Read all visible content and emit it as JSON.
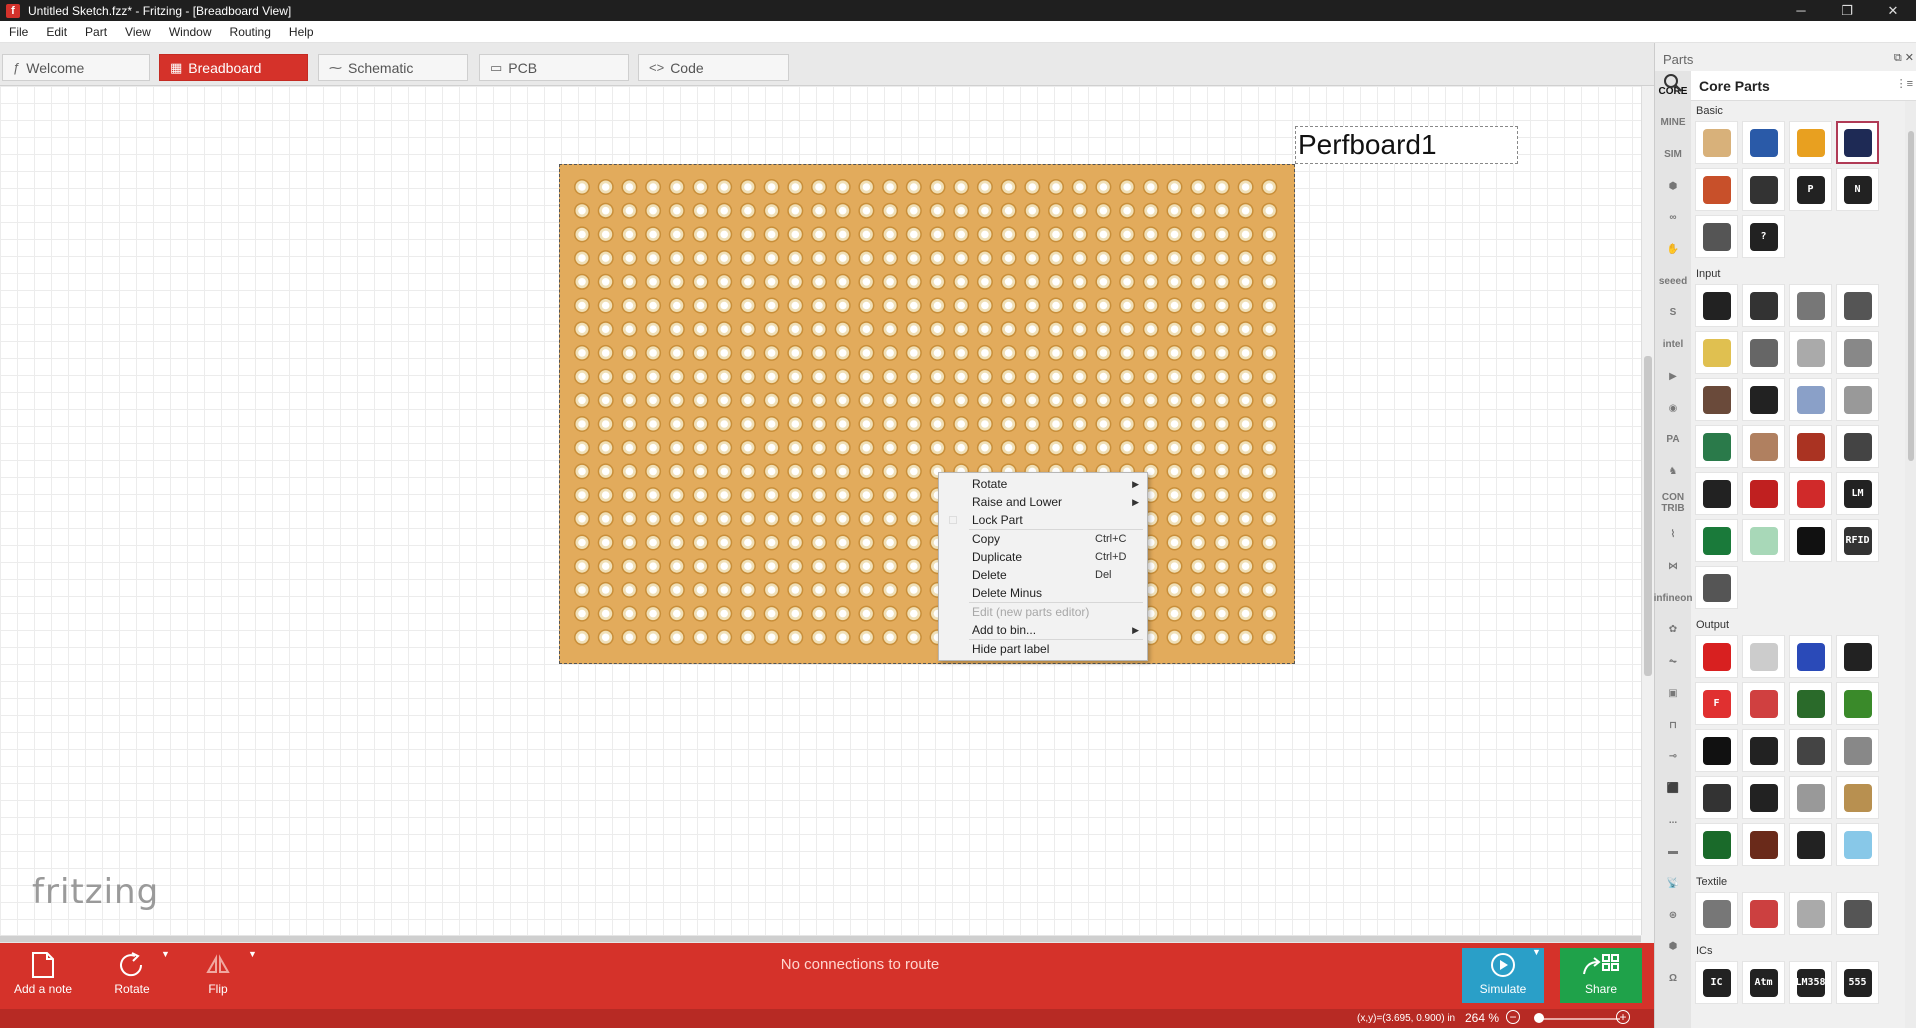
{
  "window": {
    "title": "Untitled Sketch.fzz* - Fritzing - [Breadboard View]",
    "controls": [
      "─",
      "❐",
      "✕"
    ]
  },
  "menu": [
    "File",
    "Edit",
    "Part",
    "View",
    "Window",
    "Routing",
    "Help"
  ],
  "tabs": [
    {
      "label": "Welcome",
      "icon": "ƒ",
      "active": false
    },
    {
      "label": "Breadboard",
      "icon": "▦",
      "active": true
    },
    {
      "label": "Schematic",
      "icon": "⁓",
      "active": false
    },
    {
      "label": "PCB",
      "icon": "▭",
      "active": false
    },
    {
      "label": "Code",
      "icon": "<>",
      "active": false
    }
  ],
  "canvas": {
    "part_label": "Perfboard1",
    "watermark": "fritzing",
    "perfboard": {
      "columns": 30,
      "rows": 20,
      "color": "#e2ab5c"
    }
  },
  "context_menu": [
    {
      "label": "Rotate",
      "shortcut": "",
      "submenu": true,
      "disabled": false
    },
    {
      "label": "Raise and Lower",
      "shortcut": "",
      "submenu": true,
      "disabled": false
    },
    {
      "label": "Lock Part",
      "shortcut": "",
      "submenu": false,
      "disabled": false
    },
    {
      "label": "Copy",
      "shortcut": "Ctrl+C",
      "submenu": false,
      "disabled": false
    },
    {
      "label": "Duplicate",
      "shortcut": "Ctrl+D",
      "submenu": false,
      "disabled": false
    },
    {
      "label": "Delete",
      "shortcut": "Del",
      "submenu": false,
      "disabled": false
    },
    {
      "label": "Delete Minus",
      "shortcut": "",
      "submenu": false,
      "disabled": false
    },
    {
      "label": "Edit (new parts editor)",
      "shortcut": "",
      "submenu": false,
      "disabled": true
    },
    {
      "label": "Add to bin...",
      "shortcut": "",
      "submenu": true,
      "disabled": false
    },
    {
      "label": "Hide part label",
      "shortcut": "",
      "submenu": false,
      "disabled": false
    }
  ],
  "toolbar": {
    "add_note": "Add a note",
    "rotate": "Rotate",
    "flip": "Flip",
    "route_status": "No connections to route",
    "simulate": "Simulate",
    "share": "Share"
  },
  "status": {
    "coords": "(x,y)=(3.695, 0.900) in",
    "zoom": "264 %"
  },
  "parts_panel": {
    "title": "Parts",
    "header": "Core Parts",
    "rail": [
      "CORE",
      "MINE",
      "SIM",
      "⬢",
      "∞",
      "✋",
      "seeed",
      "S",
      "intel",
      "▶",
      "◉",
      "PA",
      "♞",
      "CON TRIB",
      "⌇",
      "⋈",
      "infineon",
      "✿",
      "⏦",
      "▣",
      "⊓",
      "⊸",
      "⬛",
      "...",
      "▬",
      "📡",
      "⊛",
      "⬢",
      "Ω"
    ],
    "sections": [
      {
        "label": "Basic",
        "tiles": [
          {
            "name": "resistor",
            "color": "#d8b17a",
            "text": ""
          },
          {
            "name": "ceramic-capacitor",
            "color": "#2a5aa8",
            "text": ""
          },
          {
            "name": "tantalum-capacitor",
            "color": "#e8a020",
            "text": ""
          },
          {
            "name": "electrolytic-capacitor",
            "color": "#1e2a55",
            "text": ""
          },
          {
            "name": "inductor",
            "color": "#c8502a",
            "text": ""
          },
          {
            "name": "diode",
            "color": "#333333",
            "text": ""
          },
          {
            "name": "pnp-transistor",
            "color": "#222222",
            "text": "P"
          },
          {
            "name": "npn-transistor",
            "color": "#222222",
            "text": "N"
          },
          {
            "name": "fet",
            "color": "#555555",
            "text": ""
          },
          {
            "name": "mystery-part",
            "color": "#222222",
            "text": "?"
          }
        ]
      },
      {
        "label": "Input",
        "tiles": [
          {
            "name": "potentiometer",
            "color": "#222222",
            "text": ""
          },
          {
            "name": "slide-potentiometer",
            "color": "#333333",
            "text": ""
          },
          {
            "name": "wire-sensor",
            "color": "#777777",
            "text": ""
          },
          {
            "name": "strip-sensor",
            "color": "#555555",
            "text": ""
          },
          {
            "name": "trimmer",
            "color": "#e0c050",
            "text": ""
          },
          {
            "name": "rotary-encoder",
            "color": "#666666",
            "text": ""
          },
          {
            "name": "dip-switch",
            "color": "#aaaaaa",
            "text": ""
          },
          {
            "name": "reed-switch",
            "color": "#888888",
            "text": ""
          },
          {
            "name": "pushbutton",
            "color": "#6a4a3a",
            "text": ""
          },
          {
            "name": "toggle-switch",
            "color": "#222222",
            "text": ""
          },
          {
            "name": "piezo",
            "color": "#8aa0c8",
            "text": ""
          },
          {
            "name": "tilt-switch",
            "color": "#999999",
            "text": ""
          },
          {
            "name": "joystick",
            "color": "#2a7a4a",
            "text": ""
          },
          {
            "name": "flex-sensor",
            "color": "#b08060",
            "text": ""
          },
          {
            "name": "fsr",
            "color": "#aa3322",
            "text": ""
          },
          {
            "name": "pir-sensor",
            "color": "#444444",
            "text": ""
          },
          {
            "name": "rotary-knob",
            "color": "#222222",
            "text": ""
          },
          {
            "name": "red-breakout",
            "color": "#c02020",
            "text": ""
          },
          {
            "name": "red-sensor-board",
            "color": "#d02a2a",
            "text": ""
          },
          {
            "name": "temp-sensor",
            "color": "#222222",
            "text": "LM"
          },
          {
            "name": "green-board",
            "color": "#1a7a3a",
            "text": ""
          },
          {
            "name": "glass-tube",
            "color": "#a8d8b8",
            "text": ""
          },
          {
            "name": "microphone",
            "color": "#111111",
            "text": ""
          },
          {
            "name": "rfid-reader",
            "color": "#333333",
            "text": "RFID"
          },
          {
            "name": "keypad",
            "color": "#555555",
            "text": ""
          }
        ]
      },
      {
        "label": "Output",
        "tiles": [
          {
            "name": "red-led",
            "color": "#d82020",
            "text": ""
          },
          {
            "name": "white-led",
            "color": "#cccccc",
            "text": ""
          },
          {
            "name": "blue-led",
            "color": "#2a4ab8",
            "text": ""
          },
          {
            "name": "led-ring",
            "color": "#222222",
            "text": ""
          },
          {
            "name": "seven-segment",
            "color": "#e03030",
            "text": "F"
          },
          {
            "name": "led-matrix",
            "color": "#d04040",
            "text": ""
          },
          {
            "name": "lcd",
            "color": "#2a6a2a",
            "text": ""
          },
          {
            "name": "lcd-large",
            "color": "#3a8a2a",
            "text": ""
          },
          {
            "name": "buzzer",
            "color": "#111111",
            "text": ""
          },
          {
            "name": "speaker",
            "color": "#222222",
            "text": ""
          },
          {
            "name": "stepper",
            "color": "#444444",
            "text": ""
          },
          {
            "name": "dc-motor",
            "color": "#888888",
            "text": ""
          },
          {
            "name": "motor-driver",
            "color": "#333333",
            "text": ""
          },
          {
            "name": "servo",
            "color": "#222222",
            "text": ""
          },
          {
            "name": "vibration-motor",
            "color": "#999999",
            "text": ""
          },
          {
            "name": "solenoid",
            "color": "#b89050",
            "text": ""
          },
          {
            "name": "green-pcb",
            "color": "#1a6a2a",
            "text": ""
          },
          {
            "name": "relay-board",
            "color": "#6a2a1a",
            "text": ""
          },
          {
            "name": "driver-chip",
            "color": "#222222",
            "text": ""
          },
          {
            "name": "lamp",
            "color": "#88c8e8",
            "text": ""
          }
        ]
      },
      {
        "label": "Textile",
        "tiles": [
          {
            "name": "conductive-fabric",
            "color": "#777777",
            "text": ""
          },
          {
            "name": "conductive-thread",
            "color": "#cc4040",
            "text": ""
          },
          {
            "name": "textile-patch",
            "color": "#aaaaaa",
            "text": ""
          },
          {
            "name": "textile-wire",
            "color": "#555555",
            "text": ""
          }
        ]
      },
      {
        "label": "ICs",
        "tiles": [
          {
            "name": "ic",
            "color": "#222222",
            "text": "IC"
          },
          {
            "name": "atmega",
            "color": "#222222",
            "text": "Atm"
          },
          {
            "name": "lm358",
            "color": "#222222",
            "text": "LM358"
          },
          {
            "name": "timer-555",
            "color": "#222222",
            "text": "555"
          }
        ]
      }
    ]
  }
}
